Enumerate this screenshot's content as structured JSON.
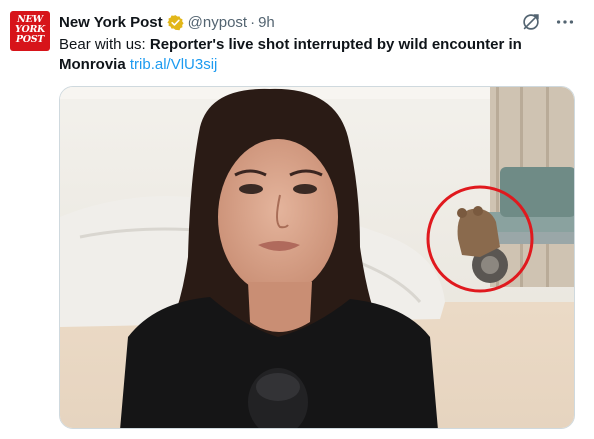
{
  "tweet": {
    "avatar_text": [
      "NEW",
      "YORK",
      "POST"
    ],
    "author_name": "New York Post",
    "verified": "gold-verified-badge",
    "handle": "@nypost",
    "separator": "·",
    "time": "9h",
    "text_prefix": "Bear with us: ",
    "text_bold": "Reporter's live shot interrupted by wild encounter in Monrovia",
    "link": "trib.al/VlU3sij",
    "media_alt": "Reporter doing live shot with a bear circled in red in the background"
  },
  "icons": {
    "grok": "grok-icon",
    "more": "more-icon"
  },
  "colors": {
    "brand_red": "#d7141a",
    "link_blue": "#1d9bf0",
    "badge_gold": "#e2b719",
    "circle_red": "#e0191e"
  }
}
